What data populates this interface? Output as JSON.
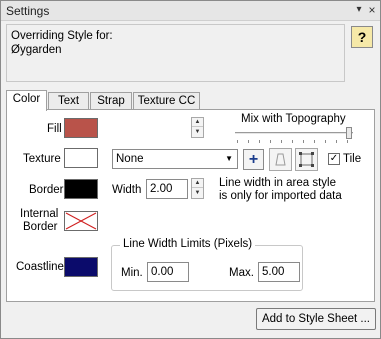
{
  "window": {
    "title": "Settings"
  },
  "override": {
    "line1": "Overriding Style for:",
    "line2": "Øygarden"
  },
  "help": {
    "label": "?"
  },
  "tabs": [
    {
      "label": "Color",
      "active": true
    },
    {
      "label": "Text",
      "active": false
    },
    {
      "label": "Strap",
      "active": false
    },
    {
      "label": "Texture CC",
      "active": false
    }
  ],
  "color_tab": {
    "fill": {
      "label": "Fill",
      "color": "#b9534a"
    },
    "mix": {
      "label": "Mix with Topography",
      "level": 1.0
    },
    "texture": {
      "label": "Texture",
      "color": "#ffffff",
      "selected": "None",
      "tile_label": "Tile",
      "tile_checked": true
    },
    "border": {
      "label": "Border",
      "color": "#000000",
      "width_label": "Width",
      "width_value": "2.00"
    },
    "border_note": {
      "line1": "Line width in area style",
      "line2": "is only for imported data"
    },
    "internal_border": {
      "label_line1": "Internal",
      "label_line2": "Border"
    },
    "coastline": {
      "label": "Coastline",
      "color": "#0b0b6b"
    },
    "line_width_limits": {
      "legend": "Line Width Limits (Pixels)",
      "min_label": "Min.",
      "min_value": "0.00",
      "max_label": "Max.",
      "max_value": "5.00"
    }
  },
  "footer": {
    "add_button": "Add to Style Sheet ..."
  }
}
